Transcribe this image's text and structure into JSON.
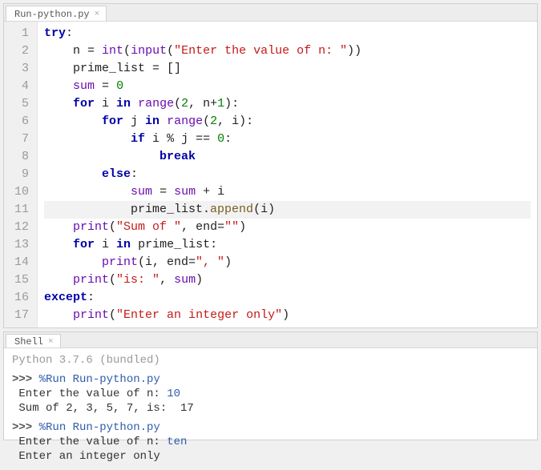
{
  "editor": {
    "tab": {
      "label": "Run-python.py"
    },
    "lines": [
      {
        "n": 1,
        "tokens": [
          [
            "kw",
            "try"
          ],
          [
            "op",
            ":"
          ]
        ]
      },
      {
        "n": 2,
        "tokens": [
          [
            "id",
            "    n "
          ],
          [
            "op",
            "= "
          ],
          [
            "bi",
            "int"
          ],
          [
            "op",
            "("
          ],
          [
            "bi",
            "input"
          ],
          [
            "op",
            "("
          ],
          [
            "str",
            "\"Enter the value of n: \""
          ],
          [
            "op",
            "))"
          ]
        ]
      },
      {
        "n": 3,
        "tokens": [
          [
            "id",
            "    prime_list "
          ],
          [
            "op",
            "= []"
          ]
        ]
      },
      {
        "n": 4,
        "tokens": [
          [
            "id",
            "    "
          ],
          [
            "bi",
            "sum"
          ],
          [
            "id",
            " "
          ],
          [
            "op",
            "= "
          ],
          [
            "num",
            "0"
          ]
        ]
      },
      {
        "n": 5,
        "tokens": [
          [
            "id",
            "    "
          ],
          [
            "kw",
            "for"
          ],
          [
            "id",
            " i "
          ],
          [
            "kw",
            "in"
          ],
          [
            "id",
            " "
          ],
          [
            "bi",
            "range"
          ],
          [
            "op",
            "("
          ],
          [
            "num",
            "2"
          ],
          [
            "op",
            ", n"
          ],
          [
            "op",
            "+"
          ],
          [
            "num",
            "1"
          ],
          [
            "op",
            "):"
          ]
        ]
      },
      {
        "n": 6,
        "tokens": [
          [
            "id",
            "        "
          ],
          [
            "kw",
            "for"
          ],
          [
            "id",
            " j "
          ],
          [
            "kw",
            "in"
          ],
          [
            "id",
            " "
          ],
          [
            "bi",
            "range"
          ],
          [
            "op",
            "("
          ],
          [
            "num",
            "2"
          ],
          [
            "op",
            ", i):"
          ]
        ]
      },
      {
        "n": 7,
        "tokens": [
          [
            "id",
            "            "
          ],
          [
            "kw",
            "if"
          ],
          [
            "id",
            " i "
          ],
          [
            "op",
            "% j == "
          ],
          [
            "num",
            "0"
          ],
          [
            "op",
            ":"
          ]
        ]
      },
      {
        "n": 8,
        "tokens": [
          [
            "id",
            "                "
          ],
          [
            "kw",
            "break"
          ]
        ]
      },
      {
        "n": 9,
        "tokens": [
          [
            "id",
            "        "
          ],
          [
            "kw",
            "else"
          ],
          [
            "op",
            ":"
          ]
        ]
      },
      {
        "n": 10,
        "tokens": [
          [
            "id",
            "            "
          ],
          [
            "bi",
            "sum"
          ],
          [
            "id",
            " "
          ],
          [
            "op",
            "= "
          ],
          [
            "bi",
            "sum"
          ],
          [
            "id",
            " "
          ],
          [
            "op",
            "+ i"
          ]
        ]
      },
      {
        "n": 11,
        "hl": true,
        "tokens": [
          [
            "id",
            "            prime_list."
          ],
          [
            "fn",
            "append"
          ],
          [
            "op",
            "(i)"
          ]
        ]
      },
      {
        "n": 12,
        "tokens": [
          [
            "id",
            "    "
          ],
          [
            "bi",
            "print"
          ],
          [
            "op",
            "("
          ],
          [
            "str",
            "\"Sum of \""
          ],
          [
            "op",
            ", end="
          ],
          [
            "str",
            "\"\""
          ],
          [
            "op",
            ")"
          ]
        ]
      },
      {
        "n": 13,
        "tokens": [
          [
            "id",
            "    "
          ],
          [
            "kw",
            "for"
          ],
          [
            "id",
            " i "
          ],
          [
            "kw",
            "in"
          ],
          [
            "id",
            " prime_list:"
          ]
        ]
      },
      {
        "n": 14,
        "tokens": [
          [
            "id",
            "        "
          ],
          [
            "bi",
            "print"
          ],
          [
            "op",
            "(i, end="
          ],
          [
            "str",
            "\", \""
          ],
          [
            "op",
            ")"
          ]
        ]
      },
      {
        "n": 15,
        "tokens": [
          [
            "id",
            "    "
          ],
          [
            "bi",
            "print"
          ],
          [
            "op",
            "("
          ],
          [
            "str",
            "\"is: \""
          ],
          [
            "op",
            ", "
          ],
          [
            "bi",
            "sum"
          ],
          [
            "op",
            ")"
          ]
        ]
      },
      {
        "n": 16,
        "tokens": [
          [
            "kw",
            "except"
          ],
          [
            "op",
            ":"
          ]
        ]
      },
      {
        "n": 17,
        "tokens": [
          [
            "id",
            "    "
          ],
          [
            "bi",
            "print"
          ],
          [
            "op",
            "("
          ],
          [
            "str",
            "\"Enter an integer only\""
          ],
          [
            "op",
            ")"
          ]
        ]
      }
    ]
  },
  "shell": {
    "tab": {
      "label": "Shell"
    },
    "lines": [
      {
        "cls": "shell-faint",
        "text": "Python 3.7.6 (bundled)"
      },
      {
        "spans": [
          [
            "prompt",
            ">>> "
          ],
          [
            "cmd",
            "%Run Run-python.py"
          ]
        ]
      },
      {
        "spans": [
          [
            "out",
            " Enter the value of n: "
          ],
          [
            "userin",
            "10"
          ]
        ]
      },
      {
        "spans": [
          [
            "out",
            " Sum of 2, 3, 5, 7, is:  17"
          ]
        ]
      },
      {
        "spans": [
          [
            "prompt",
            ">>> "
          ],
          [
            "cmd",
            "%Run Run-python.py"
          ]
        ]
      },
      {
        "spans": [
          [
            "out",
            " Enter the value of n: "
          ],
          [
            "userin",
            "ten"
          ]
        ]
      },
      {
        "spans": [
          [
            "out",
            " Enter an integer only"
          ]
        ]
      }
    ]
  }
}
